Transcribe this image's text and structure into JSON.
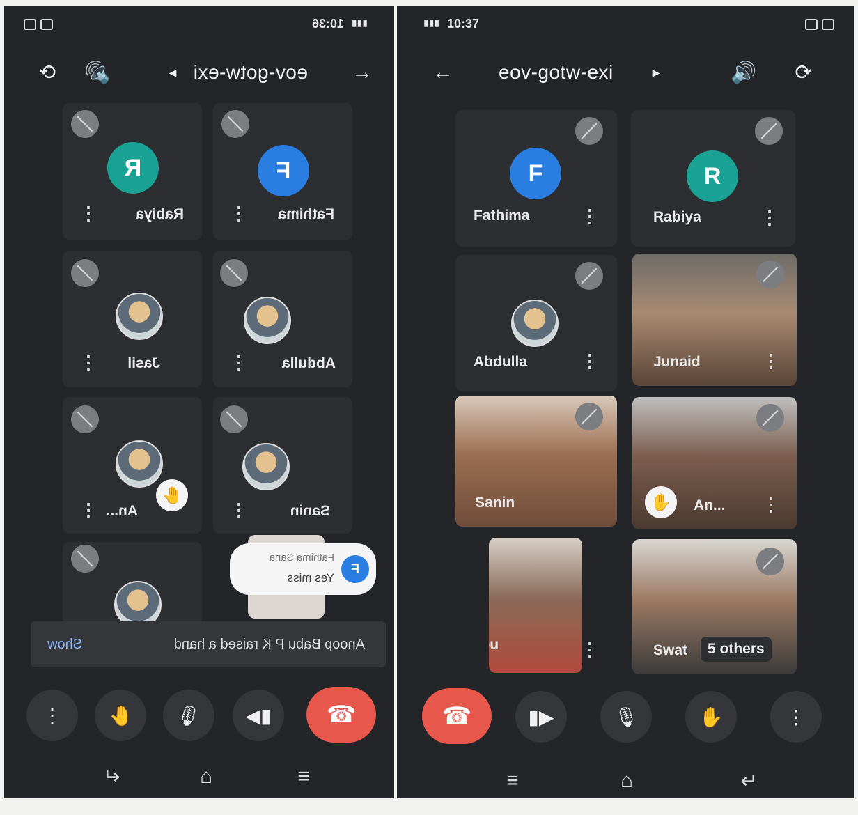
{
  "left": {
    "status": {
      "time": "10:36"
    },
    "meeting_code": "eov-gotw-exi",
    "tiles": [
      {
        "name": "Rabiya",
        "initial": "R",
        "color": "#1aa394"
      },
      {
        "name": "Fathima",
        "initial": "F",
        "color": "#2a7de1"
      },
      {
        "name": "Jasil"
      },
      {
        "name": "Abdulla"
      },
      {
        "name": "An..."
      },
      {
        "name": "Sanin"
      }
    ],
    "chat": {
      "sender": "Fathima Sana",
      "initial": "F",
      "message": "Yes miss"
    },
    "notice": {
      "text": "Anoop Babu P K raised a hand",
      "action": "Show"
    }
  },
  "right": {
    "status": {
      "time": "10:37"
    },
    "meeting_code": "eov-gotw-exi",
    "tiles": [
      {
        "name": "Fathima",
        "initial": "F",
        "color": "#2a7de1"
      },
      {
        "name": "Rabiya",
        "initial": "R",
        "color": "#1aa394"
      },
      {
        "name": "Abdulla"
      },
      {
        "name": "Junaid"
      },
      {
        "name": "Sanin"
      },
      {
        "name": "An..."
      },
      {
        "name": "You"
      },
      {
        "name": "Swat"
      }
    ],
    "others_label": "5 others"
  },
  "icons": {
    "back": "arrow-left-icon",
    "speaker": "speaker-icon",
    "switch_camera": "switch-camera-icon",
    "mic_off": "mic-off-icon",
    "more": "more-vertical-icon",
    "raise_hand": "raise-hand-icon",
    "mic": "mic-icon",
    "camera": "camera-icon",
    "end_call": "end-call-icon"
  },
  "colors": {
    "end_call": "#e8574b",
    "background": "#242528"
  }
}
